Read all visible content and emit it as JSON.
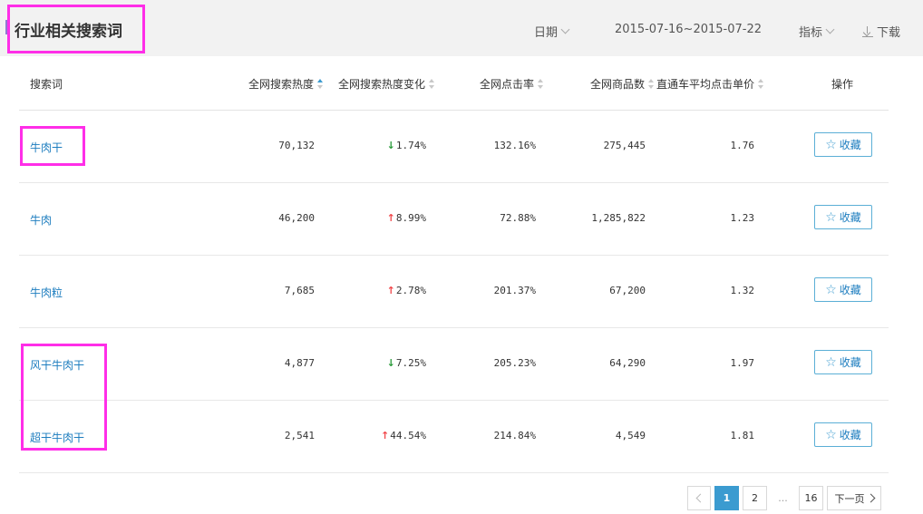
{
  "header": {
    "title": "行业相关搜索词",
    "date_label": "日期",
    "date_range": "2015-07-16~2015-07-22",
    "metric_label": "指标",
    "download_label": "下载"
  },
  "table": {
    "columns": [
      "搜索词",
      "全网搜索热度",
      "全网搜索热度变化",
      "全网点击率",
      "全网商品数",
      "直通车平均点击单价",
      "操作"
    ],
    "rows": [
      {
        "keyword": "牛肉干",
        "heat": "70,132",
        "change": "1.74%",
        "trend": "down",
        "ctr": "132.16%",
        "items": "275,445",
        "cpc": "1.76",
        "action": "收藏"
      },
      {
        "keyword": "牛肉",
        "heat": "46,200",
        "change": "8.99%",
        "trend": "up",
        "ctr": "72.88%",
        "items": "1,285,822",
        "cpc": "1.23",
        "action": "收藏"
      },
      {
        "keyword": "牛肉粒",
        "heat": "7,685",
        "change": "2.78%",
        "trend": "up",
        "ctr": "201.37%",
        "items": "67,200",
        "cpc": "1.32",
        "action": "收藏"
      },
      {
        "keyword": "风干牛肉干",
        "heat": "4,877",
        "change": "7.25%",
        "trend": "down",
        "ctr": "205.23%",
        "items": "64,290",
        "cpc": "1.97",
        "action": "收藏"
      },
      {
        "keyword": "超干牛肉干",
        "heat": "2,541",
        "change": "44.54%",
        "trend": "up",
        "ctr": "214.84%",
        "items": "4,549",
        "cpc": "1.81",
        "action": "收藏"
      }
    ]
  },
  "pagination": {
    "pages": [
      "1",
      "2"
    ],
    "ellipsis": "...",
    "last_page": "16",
    "next_label": "下一页",
    "current": "1"
  },
  "colors": {
    "highlight_box": "#ff2ee8",
    "link": "#1d7dbf",
    "accent": "#3b9bd0",
    "trend_up": "#f1474a",
    "trend_down": "#2a9a3a",
    "header_bg": "#f2f2f2"
  },
  "icons": {
    "trend_up": "↑",
    "trend_down": "↓",
    "star": "☆"
  }
}
